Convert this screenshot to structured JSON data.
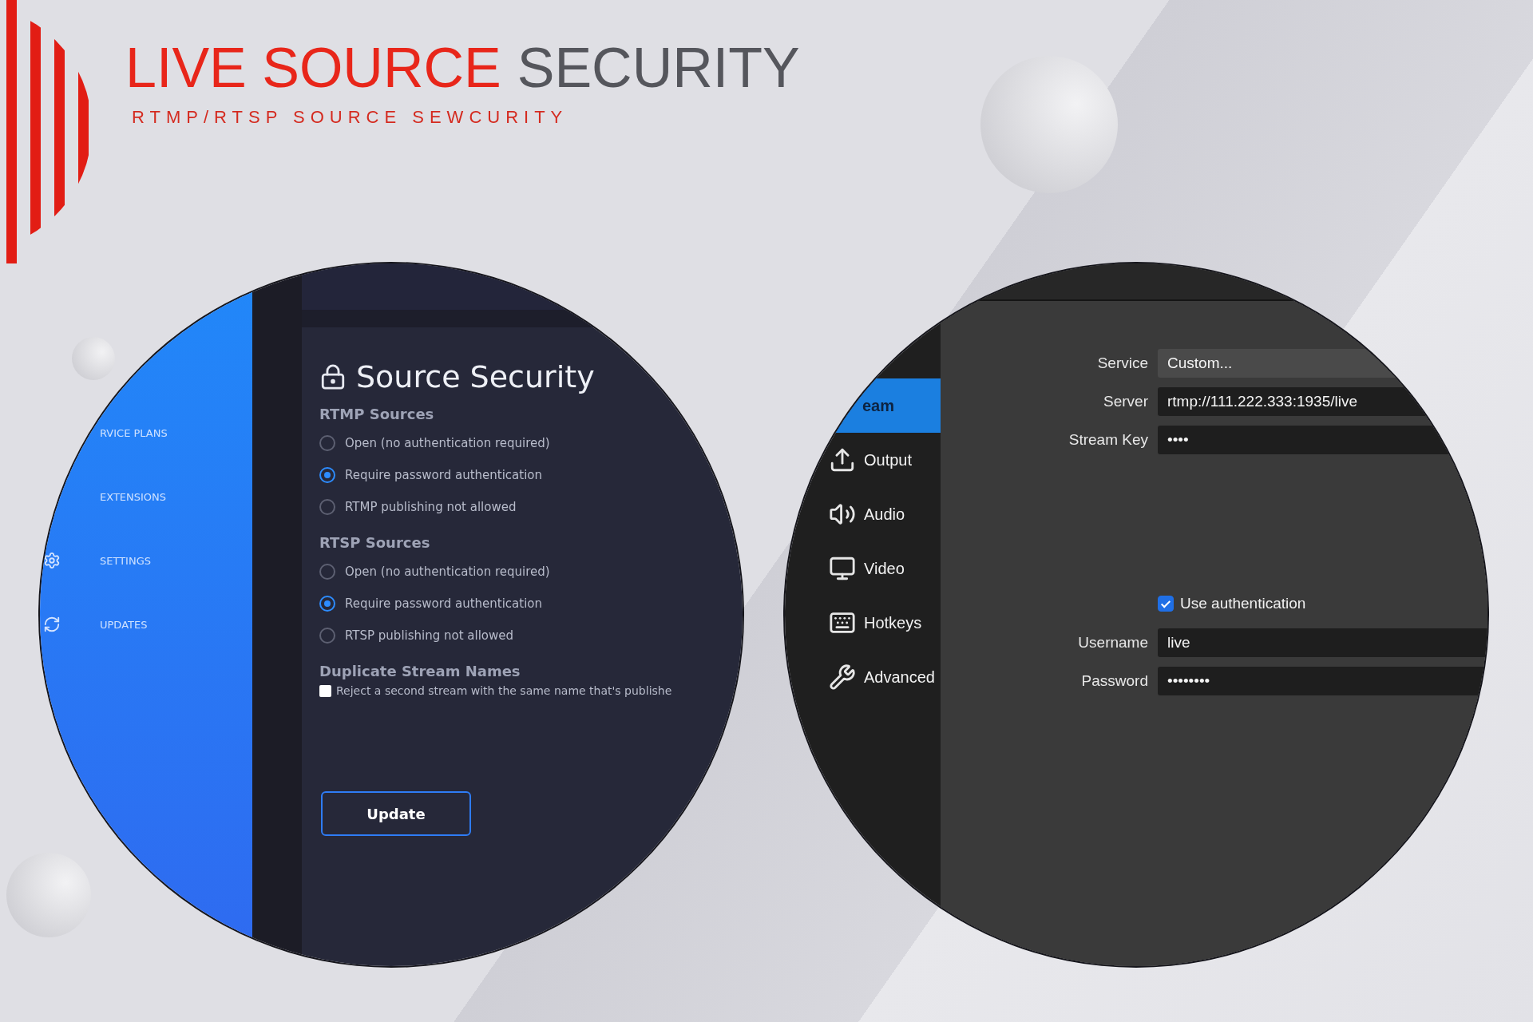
{
  "brand": {
    "title_accent": "LIVE SOURCE",
    "title_rest": "SECURITY",
    "tagline": "RTMP/RTSP SOURCE SEWCURITY"
  },
  "admin_panel": {
    "sidebar": [
      {
        "label": "RVICE PLANS"
      },
      {
        "label": "EXTENSIONS"
      },
      {
        "label": "SETTINGS"
      },
      {
        "label": "UPDATES"
      }
    ],
    "title": "Source Security",
    "sections": [
      {
        "heading": "RTMP Sources",
        "options": [
          {
            "label": "Open (no authentication required)",
            "selected": false
          },
          {
            "label": "Require password authentication",
            "selected": true
          },
          {
            "label": "RTMP publishing not allowed",
            "selected": false
          }
        ]
      },
      {
        "heading": "RTSP Sources",
        "options": [
          {
            "label": "Open (no authentication required)",
            "selected": false
          },
          {
            "label": "Require password authentication",
            "selected": true
          },
          {
            "label": "RTSP publishing not allowed",
            "selected": false
          }
        ]
      }
    ],
    "duplicate": {
      "heading": "Duplicate Stream Names",
      "label": "Reject a second stream with the same name that's publishe",
      "checked": false
    },
    "update_button": "Update"
  },
  "stream_settings": {
    "sidebar": [
      {
        "label": "eam",
        "selected": true
      },
      {
        "label": "Output",
        "selected": false
      },
      {
        "label": "Audio",
        "selected": false
      },
      {
        "label": "Video",
        "selected": false
      },
      {
        "label": "Hotkeys",
        "selected": false
      },
      {
        "label": "Advanced",
        "selected": false
      }
    ],
    "fields": [
      {
        "label": "Service",
        "value": "Custom...",
        "kind": "select"
      },
      {
        "label": "Server",
        "value": "rtmp://111.222.333:1935/live",
        "kind": "text"
      },
      {
        "label": "Stream Key",
        "value": "••••",
        "kind": "text"
      }
    ],
    "use_authentication": {
      "label": "Use authentication",
      "checked": true
    },
    "auth_fields": [
      {
        "label": "Username",
        "value": "live"
      },
      {
        "label": "Password",
        "value": "••••••••"
      }
    ]
  }
}
